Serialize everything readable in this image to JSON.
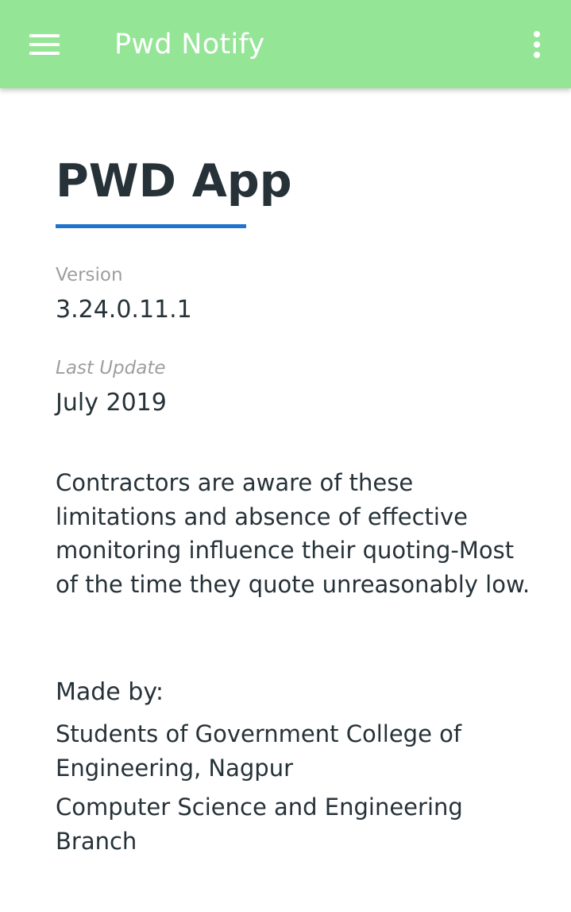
{
  "appbar": {
    "title": "Pwd Notify",
    "menu_icon": "hamburger-menu-icon",
    "overflow_icon": "more-vert-icon",
    "background_color": "#95e597",
    "title_color": "#ffffff"
  },
  "main": {
    "title": "PWD App",
    "underline_color": "#1f74cf",
    "version_label": "Version",
    "version_value": "3.24.0.11.1",
    "last_update_label": "Last Update",
    "last_update_value": "July 2019",
    "description": "Contractors are aware of these limitations and absence of effective monitoring influence their quoting-Most of the time they quote unreasonably low.",
    "made_by_label": "Made by:",
    "credits": [
      "Students of Government College of Engineering, Nagpur",
      "Computer Science and Engineering Branch"
    ]
  }
}
